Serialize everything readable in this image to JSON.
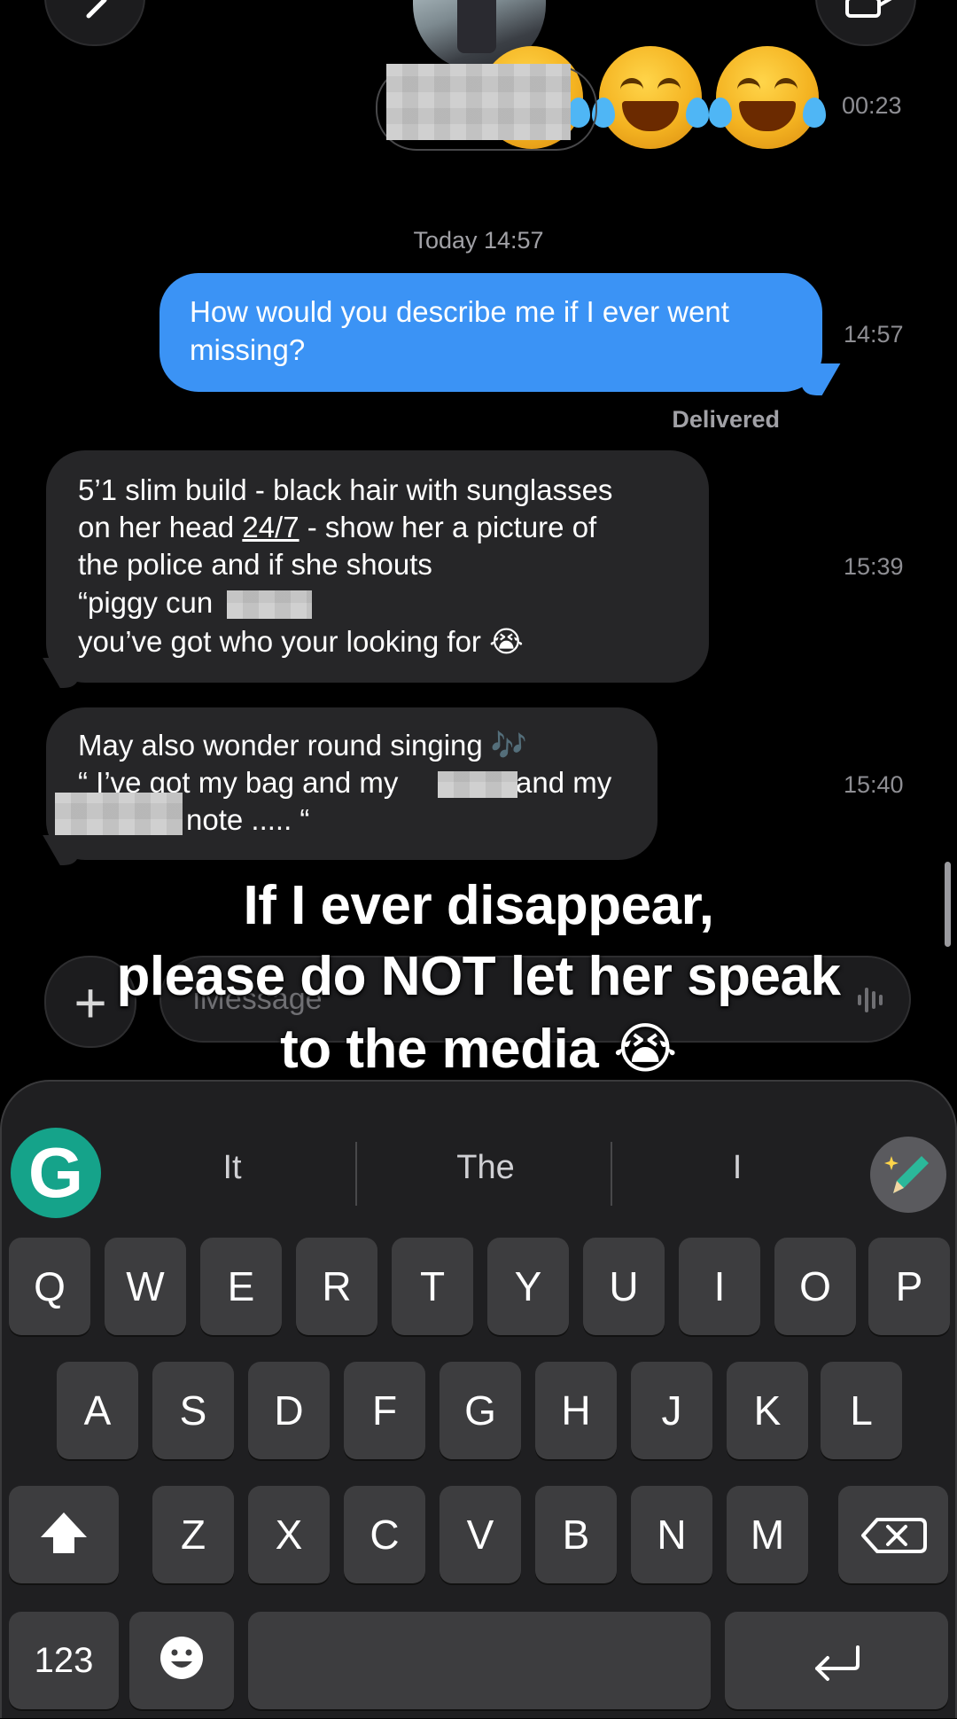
{
  "header": {
    "back_icon": "chevron-left-icon",
    "video_icon": "video-camera-icon"
  },
  "previous_message": {
    "emojis": [
      "face-with-tears-of-joy",
      "face-with-tears-of-joy",
      "face-with-tears-of-joy"
    ],
    "time": "00:23"
  },
  "divider": {
    "label": "Today 14:57"
  },
  "messages": [
    {
      "direction": "outgoing",
      "lines": [
        "How would you describe me if I ever went",
        "missing?"
      ],
      "time": "14:57",
      "status": "Delivered"
    },
    {
      "direction": "incoming",
      "lines": [
        "5’1 slim build - black hair with sunglasses",
        "on her head ",
        "24/7",
        " - show her a picture of",
        "the police and if she shouts",
        "“piggy cun",
        "you’ve got who your looking for 😭"
      ],
      "time": "15:39"
    },
    {
      "direction": "incoming",
      "lines": [
        "May also wonder round singing 🎶",
        "“ I’ve got my bag and my ",
        "and my",
        "note ..... “"
      ],
      "time": "15:40"
    }
  ],
  "caption": {
    "lines": [
      "If I ever disappear,",
      "please do NOT let her speak",
      "to the media 😭"
    ]
  },
  "composer": {
    "plus_label": "+",
    "placeholder": "iMessage"
  },
  "keyboard": {
    "suggestions": [
      "It",
      "The",
      "I"
    ],
    "grammarly_label": "G",
    "row1": [
      "Q",
      "W",
      "E",
      "R",
      "T",
      "Y",
      "U",
      "I",
      "O",
      "P"
    ],
    "row2": [
      "A",
      "S",
      "D",
      "F",
      "G",
      "H",
      "J",
      "K",
      "L"
    ],
    "row3": [
      "Z",
      "X",
      "C",
      "V",
      "B",
      "N",
      "M"
    ],
    "numbers_label": "123",
    "shift_icon": "shift-icon",
    "delete_icon": "backspace-icon",
    "emoji_icon": "emoji-icon",
    "return_icon": "return-icon"
  },
  "colors": {
    "background": "#000000",
    "outgoing_bubble": "#3b93f5",
    "incoming_bubble": "#262628",
    "key": "#3d3d3f",
    "grammarly": "#15a38a"
  }
}
